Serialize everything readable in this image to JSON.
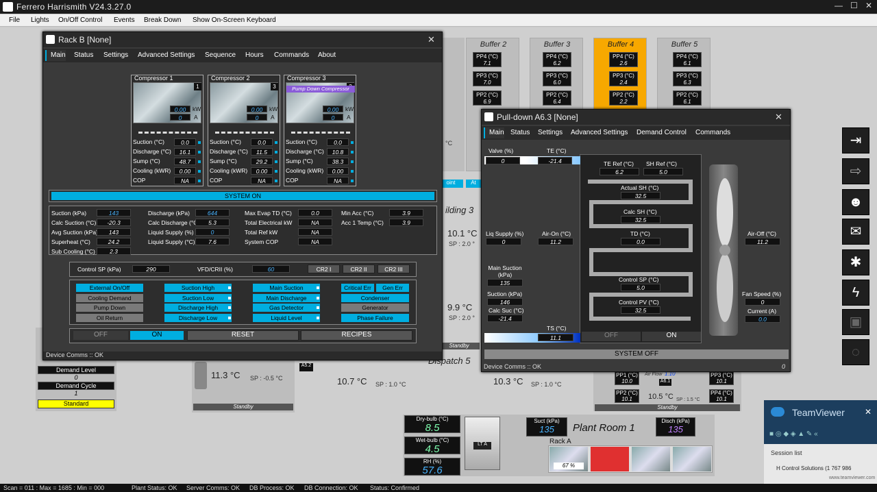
{
  "app": {
    "title": "Ferrero Harrismith V24.3.27.0",
    "min": "—",
    "max": "☐",
    "close": "✕"
  },
  "menu": [
    "File",
    "Lights",
    "On/Off Control",
    "Events",
    "Break Down",
    "Show On-Screen Keyboard"
  ],
  "buffers": [
    {
      "name": "Buffer 2",
      "pp4": "7.1",
      "pp3": "7.0",
      "pp2": "6.9"
    },
    {
      "name": "Buffer 3",
      "pp4": "6.2",
      "pp3": "6.0",
      "pp2": "6.4"
    },
    {
      "name": "Buffer 4",
      "pp4": "2.6",
      "pp3": "2.4",
      "pp2": "2.2"
    },
    {
      "name": "Buffer 5",
      "pp4": "6.1",
      "pp3": "6.3",
      "pp2": "6.1"
    }
  ],
  "labels": {
    "pp4": "PP4 (°C)",
    "pp3": "PP3 (°C)",
    "pp2": "PP2 (°C)",
    "pp1": "PP1 (°C)"
  },
  "rack": {
    "title": "Rack B [None]",
    "tabs": [
      "Main",
      "Status",
      "Settings",
      "Advanced Settings",
      "Sequence",
      "Hours",
      "Commands",
      "About"
    ],
    "row_labels": {
      "suction": "Suction (°C)",
      "discharge": "Discharge (°C)",
      "sump": "Sump (°C)",
      "cooling": "Cooling (kWR)",
      "cop": "COP"
    },
    "kw": "kW",
    "a": "A",
    "compressors": [
      {
        "name": "Compressor 1",
        "num": "1",
        "kw": "0.00",
        "amp": "0",
        "suction": "0.0",
        "discharge": "16.1",
        "sump": "48.7",
        "cooling": "0.00",
        "cop": "NA",
        "tag": ""
      },
      {
        "name": "Compressor 2",
        "num": "3",
        "kw": "0.00",
        "amp": "0",
        "suction": "0.0",
        "discharge": "11.5",
        "sump": "29.2",
        "cooling": "0.00",
        "cop": "NA",
        "tag": ""
      },
      {
        "name": "Compressor 3",
        "num": "2",
        "kw": "0.00",
        "amp": "0",
        "suction": "0.0",
        "discharge": "10.8",
        "sump": "38.3",
        "cooling": "0.00",
        "cop": "NA",
        "tag": "Pump Down Compressor"
      }
    ],
    "system_status": "SYSTEM ON",
    "params": [
      {
        "l": "Suction (kPa)",
        "v": "143"
      },
      {
        "l": "Discharge (kPa)",
        "v": "644"
      },
      {
        "l": "Max Evap TD (°C)",
        "v": "0.0"
      },
      {
        "l": "Min Acc (°C)",
        "v": "3.9"
      },
      {
        "l": "Calc Suction (°C)",
        "v": "-20.3"
      },
      {
        "l": "Calc Discharge (°C)",
        "v": "5.3"
      },
      {
        "l": "Total Electrical kW",
        "v": "NA"
      },
      {
        "l": "Acc 1 Temp (°C)",
        "v": "3.9"
      },
      {
        "l": "Avg Suction (kPa)",
        "v": "143"
      },
      {
        "l": "Liquid Supply (%)",
        "v": "0"
      },
      {
        "l": "Total Ref kW",
        "v": "NA"
      },
      {
        "l": "Superheat (°C)",
        "v": "24.2"
      },
      {
        "l": "Liquid Supply (°C)",
        "v": "7.6"
      },
      {
        "l": "System COP",
        "v": "NA"
      },
      {
        "l": "Sub Cooling (°C)",
        "v": "2.3"
      }
    ],
    "control_sp_label": "Control SP (kPa)",
    "control_sp": "290",
    "vfd_label": "VFD/CRII (%)",
    "vfd": "60",
    "cr": [
      "CR2 I",
      "CR2 II",
      "CR2 III"
    ],
    "alarms": [
      "External On/Off",
      "Cooling Demand",
      "Pump Down",
      "Oil Return",
      "Suction High",
      "Suction Low",
      "Discharge High",
      "Discharge Low",
      "Main Suction",
      "Main Discharge",
      "Gas Detector",
      "Liquid Level",
      "Critical Err",
      "Gen Err",
      "Condenser",
      "Generator",
      "Phase Failure"
    ],
    "controls": {
      "off": "OFF",
      "on": "ON",
      "reset": "RESET",
      "recipes": "RECIPES"
    },
    "comms": "Device Comms :: OK"
  },
  "pulldown": {
    "title": "Pull-down A6.3 [None]",
    "tabs": [
      "Main",
      "Status",
      "Settings",
      "Advanced Settings",
      "Demand Control",
      "Commands"
    ],
    "valve_label": "Valve (%)",
    "valve": "0",
    "te_label": "TE (°C)",
    "te": "-21.4",
    "te_ref_label": "TE Ref (°C)",
    "te_ref": "6.2",
    "sh_ref_label": "SH Ref (°C)",
    "sh_ref": "5.0",
    "actual_sh_label": "Actual SH (°C)",
    "actual_sh": "32.5",
    "calc_sh_label": "Calc SH (°C)",
    "calc_sh": "32.5",
    "td_label": "TD (°C)",
    "td": "0.0",
    "control_sp_label": "Control SP (°C)",
    "control_sp": "5.0",
    "control_pv_label": "Control PV (°C)",
    "control_pv": "32.5",
    "liq_label": "Liq Supply (%)",
    "liq": "0",
    "air_on_label": "Air-On (°C)",
    "air_on": "11.2",
    "air_off_label": "Air-Off (°C)",
    "air_off": "11.2",
    "main_suc_label": "Main Suction (kPa)",
    "main_suc": "135",
    "suc_label": "Suction (kPa)",
    "suc": "146",
    "calc_suc_label": "Calc Suc (°C)",
    "calc_suc": "-21.4",
    "ts_label": "TS (°C)",
    "ts": "11.1",
    "fan_label": "Fan Speed (%)",
    "fan": "0",
    "current_label": "Current (A)",
    "current": "0.0",
    "off": "OFF",
    "on": "ON",
    "system_status": "SYSTEM OFF",
    "comms": "Device Comms :: OK",
    "comms_num": "0"
  },
  "background": {
    "building3": "ilding 3",
    "dispatch5": "Dispatch 5",
    "t1": "10.1 °C",
    "sp1": "SP : 2.0 °",
    "t2": "9.9 °C",
    "sp2": "SP : 2.0 °",
    "t3": "11.3 °C",
    "sp3": "SP : -0.5 °C",
    "t4": "10.7 °C",
    "sp4": "SP : 1.0 °C",
    "t5": "10.3 °C",
    "sp5": "SP : 1.0 °C",
    "t6": "10.5 °C",
    "sp6": "SP : 1.5 °C",
    "standby": "Standby",
    "a52": "A5.2",
    "a61": "A6.1",
    "c_label": "°C",
    "point": "oint",
    "at": "At",
    "airflow": "Air Flow",
    "airflow_val": "1.10",
    "pp1a": "10.0",
    "pp3a": "10.1",
    "pp2a": "10.1",
    "pp4a": "10.1",
    "demand_level_label": "Demand Level",
    "demand_level": "0",
    "demand_cycle_label": "Demand Cycle",
    "demand_cycle": "1",
    "standard": "Standard"
  },
  "plant": {
    "drybulb_label": "Dry-bulb (°C)",
    "drybulb": "8.5",
    "wetbulb_label": "Wet-bulb (°C)",
    "wetbulb": "4.5",
    "rh_label": "RH (%)",
    "rh": "57.6",
    "lt": "LT A",
    "suct_label": "Suct (kPa)",
    "suct": "135",
    "disch_label": "Disch (kPa)",
    "disch": "135",
    "room": "Plant Room 1",
    "rack": "Rack A",
    "rack_pct": "67",
    "pct": "%"
  },
  "teamviewer": {
    "title": "TeamViewer",
    "session": "Session list",
    "entry": "H Control Solutions (1 767 986",
    "url": "www.teamviewer.com"
  },
  "status": {
    "scan": "Scan = 011 : Max = 1685 : Min = 000",
    "plant": "Plant Status: OK",
    "server": "Server Comms: OK",
    "db": "DB Process:  OK",
    "dbc": "DB Connection:  OK",
    "st": "Status:  Confirmed"
  },
  "colors": {
    "accent": "#00aee0",
    "buffer_active": "#f7a800",
    "red_comp": "#e03030"
  }
}
